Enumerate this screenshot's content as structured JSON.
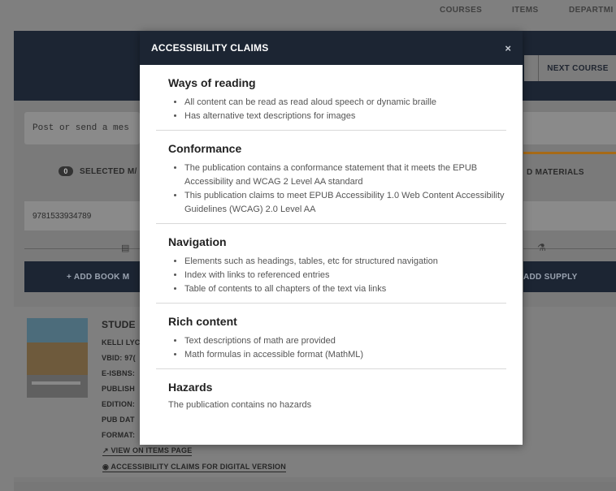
{
  "topnav": {
    "items": [
      "COURSES",
      "ITEMS",
      "DEPARTMI"
    ]
  },
  "header": {
    "next_course": "NEXT COURSE"
  },
  "message": {
    "placeholder": "Post or send a mes"
  },
  "tabs": {
    "selected_count": "0",
    "selected_label": "SELECTED M/",
    "right_label": "D MATERIALS"
  },
  "search": {
    "isbn_value": "9781533934789"
  },
  "actions": {
    "add_book": "+ ADD BOOK M",
    "add_supply": "ADD SUPPLY"
  },
  "result": {
    "title": "STUDE",
    "lines": [
      "KELLI LYC",
      "VBID: 97(",
      "E-ISBNS:",
      "PUBLISH",
      "EDITION:",
      "PUB DAT",
      "FORMAT:"
    ],
    "view_link": "VIEW ON ITEMS PAGE",
    "a11y_link": "ACCESSIBILITY CLAIMS FOR DIGITAL VERSION"
  },
  "modal": {
    "title": "ACCESSIBILITY CLAIMS",
    "close": "×",
    "sections": [
      {
        "heading": "Ways of reading",
        "items": [
          "All content can be read as read aloud speech or dynamic braille",
          "Has alternative text descriptions for images"
        ]
      },
      {
        "heading": "Conformance",
        "items": [
          "The publication contains a conformance statement that it meets the EPUB Accessibility and WCAG 2 Level AA standard",
          "This publication claims to meet EPUB Accessibility 1.0 Web Content Accessibility Guidelines (WCAG) 2.0 Level AA"
        ]
      },
      {
        "heading": "Navigation",
        "items": [
          "Elements such as headings, tables, etc for structured navigation",
          "Index with links to referenced entries",
          "Table of contents to all chapters of the text via links"
        ]
      },
      {
        "heading": "Rich content",
        "items": [
          "Text descriptions of math are provided",
          "Math formulas in accessible format (MathML)"
        ]
      },
      {
        "heading": "Hazards",
        "text": "The publication contains no hazards"
      }
    ]
  },
  "colors": {
    "header_navy": "#1c2533",
    "accent_orange": "#a66a17",
    "overlay_gray": "#7f7f7f"
  }
}
